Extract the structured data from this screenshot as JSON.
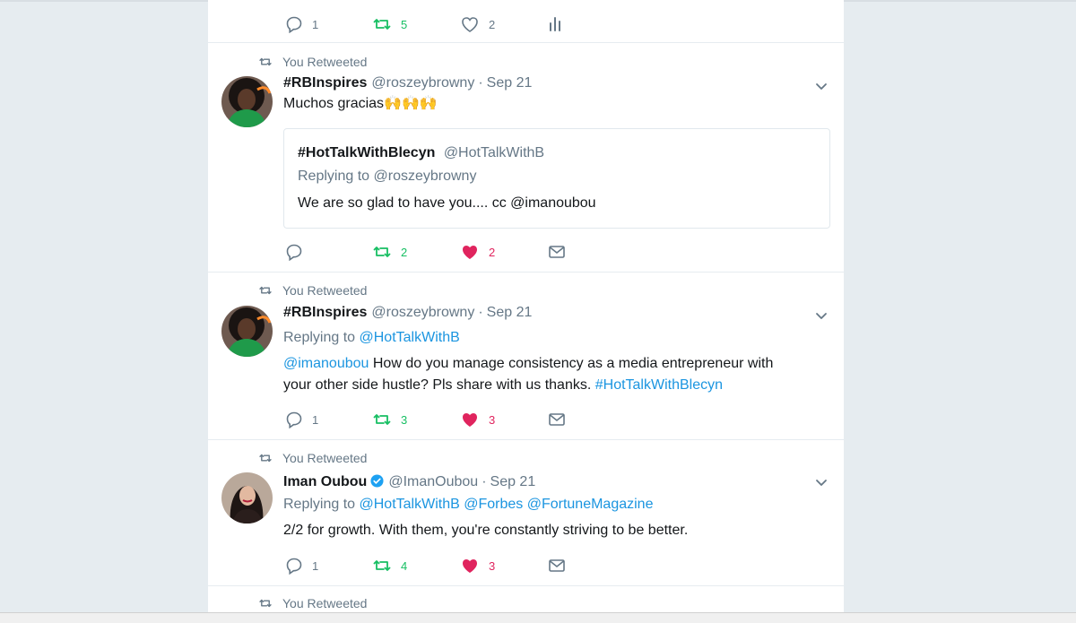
{
  "colors": {
    "background": "#e6ecf0",
    "link": "#1b95e0",
    "retweet_active": "#17bf63",
    "like_active": "#e0245e",
    "secondary_text": "#657786"
  },
  "top_tweet": {
    "reply_count": "1",
    "retweet_count": "5",
    "like_count": "2",
    "icons": [
      "reply-icon",
      "retweet-icon",
      "heart-icon",
      "analytics-icon"
    ]
  },
  "tweets": [
    {
      "context": "You Retweeted",
      "name": "#RBInspires",
      "handle": "@roszeybrowny",
      "separator": "·",
      "time": "Sep 21",
      "text": "Muchos gracias🙌🙌🙌",
      "quote": {
        "name": "#HotTalkWithBlecyn",
        "handle": "@HotTalkWithB",
        "replying_prefix": "Replying to",
        "replying_to": "@roszeybrowny",
        "text": "We are so glad to have you.... cc @imanoubou"
      },
      "reply_count": "",
      "retweet_count": "2",
      "like_count": "2"
    },
    {
      "context": "You Retweeted",
      "name": "#RBInspires",
      "handle": "@roszeybrowny",
      "separator": "·",
      "time": "Sep 21",
      "replying_prefix": "Replying to",
      "replying_to": [
        "@HotTalkWithB"
      ],
      "text_mention": "@imanoubou",
      "text_line1": " How do you manage consistency as a media entrepreneur with",
      "text_line2": "your other side hustle?  Pls share with us thanks. ",
      "text_hashtag": "#HotTalkWithBlecyn",
      "reply_count": "1",
      "retweet_count": "3",
      "like_count": "3"
    },
    {
      "context": "You Retweeted",
      "name": "Iman Oubou",
      "verified": true,
      "handle": "@ImanOubou",
      "separator": "·",
      "time": "Sep 21",
      "replying_prefix": "Replying to",
      "replying_to": [
        "@HotTalkWithB",
        "@Forbes",
        "@FortuneMagazine"
      ],
      "text": "2/2 for growth. With them, you're constantly striving to be better.",
      "reply_count": "1",
      "retweet_count": "4",
      "like_count": "3"
    },
    {
      "context": "You Retweeted"
    }
  ]
}
